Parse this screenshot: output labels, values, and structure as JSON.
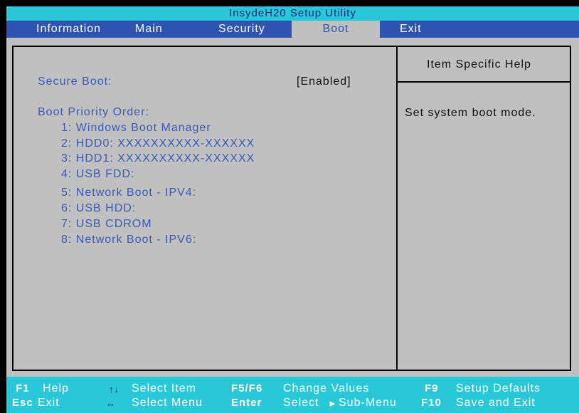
{
  "title": "InsydeH20 Setup Utility",
  "menu": {
    "information": "Information",
    "main": "Main",
    "security": "Security",
    "boot": "Boot",
    "exit": "Exit"
  },
  "settings": {
    "secure_boot_label": "Secure Boot:",
    "secure_boot_value": "[Enabled]",
    "boot_priority_label": "Boot Priority Order:",
    "boot_items": [
      "1:  Windows Boot Manager",
      "2:  HDD0: XXXXXXXXXX-XXXXXX",
      "3:  HDD1: XXXXXXXXXX-XXXXXX",
      "4:  USB FDD:",
      "5:  Network Boot - IPV4:",
      "6:  USB HDD:",
      "7:  USB CDROM",
      "8:  Network Boot - IPV6:"
    ]
  },
  "help": {
    "title": "Item Specific Help",
    "text": "Set system boot mode."
  },
  "footer": {
    "f1_key": "F1",
    "f1_desc": "Help",
    "esc_key": "Esc",
    "esc_desc": "Exit",
    "updown_icon": "↑↓",
    "select_item": "Select  Item",
    "leftright_icon": "↔",
    "select_menu": "Select  Menu",
    "f5f6_key": "F5/F6",
    "f5f6_desc": "Change Values",
    "enter_key": "Enter",
    "enter_desc": "Select",
    "submenu_arrow": "►",
    "enter_desc2": "Sub-Menu",
    "f9_key": "F9",
    "f9_desc": "Setup Defaults",
    "f10_key": "F10",
    "f10_desc": "Save and Exit"
  },
  "colors": {
    "title_bg": "#28c8d8",
    "menu_bg": "#2e54b0",
    "panel_bg": "#c0c0c0",
    "item_text": "#3a5ab8"
  }
}
